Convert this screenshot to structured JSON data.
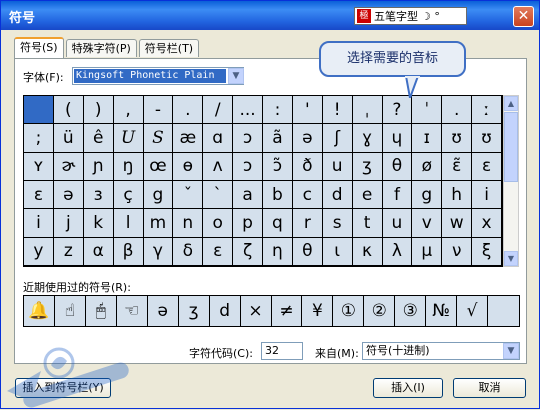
{
  "window": {
    "title": "符号"
  },
  "ime": {
    "name": "五笔字型",
    "logo": "極",
    "mode_icons": "☽ °"
  },
  "tabs": [
    {
      "label": "符号(S)",
      "active": true
    },
    {
      "label": "特殊字符(P)",
      "active": false
    },
    {
      "label": "符号栏(T)",
      "active": false
    }
  ],
  "callout": {
    "text": "选择需要的音标"
  },
  "font": {
    "label": "字体(F):",
    "value": "Kingsoft Phonetic Plain"
  },
  "symbols": [
    [
      "",
      "(",
      ")",
      ",",
      "-",
      ".",
      "/",
      "...",
      ":",
      "'",
      "!",
      "ˌ",
      "?",
      "ˈ",
      ".",
      "ː"
    ],
    [
      ";",
      "ü",
      "ê",
      "U",
      "S",
      "æ",
      "ɑ",
      "ɔ",
      "ã",
      "ə",
      "ʃ",
      "ɣ",
      "ɥ",
      "ɪ",
      "ʊ",
      "ʊ"
    ],
    [
      "ʏ",
      "ɚ",
      "ɲ",
      "ŋ",
      "œ",
      "ɵ",
      "ʌ",
      "ɔ",
      "ɔ̃",
      "ð",
      "u",
      "ʒ",
      "θ",
      "ø",
      "ɛ̃",
      "ɛ"
    ],
    [
      "ε",
      "ə",
      "з",
      "ç",
      "g",
      "ˇ",
      "`",
      "a",
      "b",
      "c",
      "d",
      "e",
      "f",
      "g",
      "h",
      "i"
    ],
    [
      "i",
      "j",
      "k",
      "l",
      "m",
      "n",
      "o",
      "p",
      "q",
      "r",
      "s",
      "t",
      "u",
      "v",
      "w",
      "x"
    ],
    [
      "y",
      "z",
      "α",
      "β",
      "γ",
      "δ",
      "ε",
      "ζ",
      "η",
      "θ",
      "ι",
      "κ",
      "λ",
      "μ",
      "ν",
      "ξ"
    ]
  ],
  "recent": {
    "label": "近期使用过的符号(R):",
    "items": [
      "🔔",
      "☝",
      "🖱",
      "☜",
      "ə",
      "ʒ",
      "d",
      "×",
      "≠",
      "¥",
      "①",
      "②",
      "③",
      "№",
      "√",
      ""
    ]
  },
  "char_code": {
    "label": "字符代码(C):",
    "value": "32"
  },
  "from": {
    "label": "来自(M):",
    "value": "符号(十进制)"
  },
  "buttons": {
    "insert_to_bar": "插入到符号栏(Y)",
    "insert": "插入(I)",
    "cancel": "取消"
  },
  "colors": {
    "titlebar": "#2265e0",
    "selection": "#316ac5",
    "cell_bg": "#d4e0ec"
  }
}
